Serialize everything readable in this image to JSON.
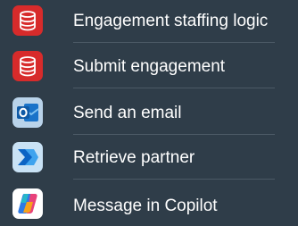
{
  "items": [
    {
      "label": "Engagement staffing logic",
      "icon": "database-icon",
      "icon_color": "#d72b2b"
    },
    {
      "label": "Submit engagement",
      "icon": "database-icon",
      "icon_color": "#d72b2b"
    },
    {
      "label": "Send an email",
      "icon": "outlook-icon",
      "icon_color": "#3f9ad8"
    },
    {
      "label": "Retrieve partner",
      "icon": "power-automate-icon",
      "icon_color": "#4aa8e0"
    },
    {
      "label": "Message in Copilot",
      "icon": "copilot-icon",
      "icon_color": "#ffffff"
    }
  ]
}
